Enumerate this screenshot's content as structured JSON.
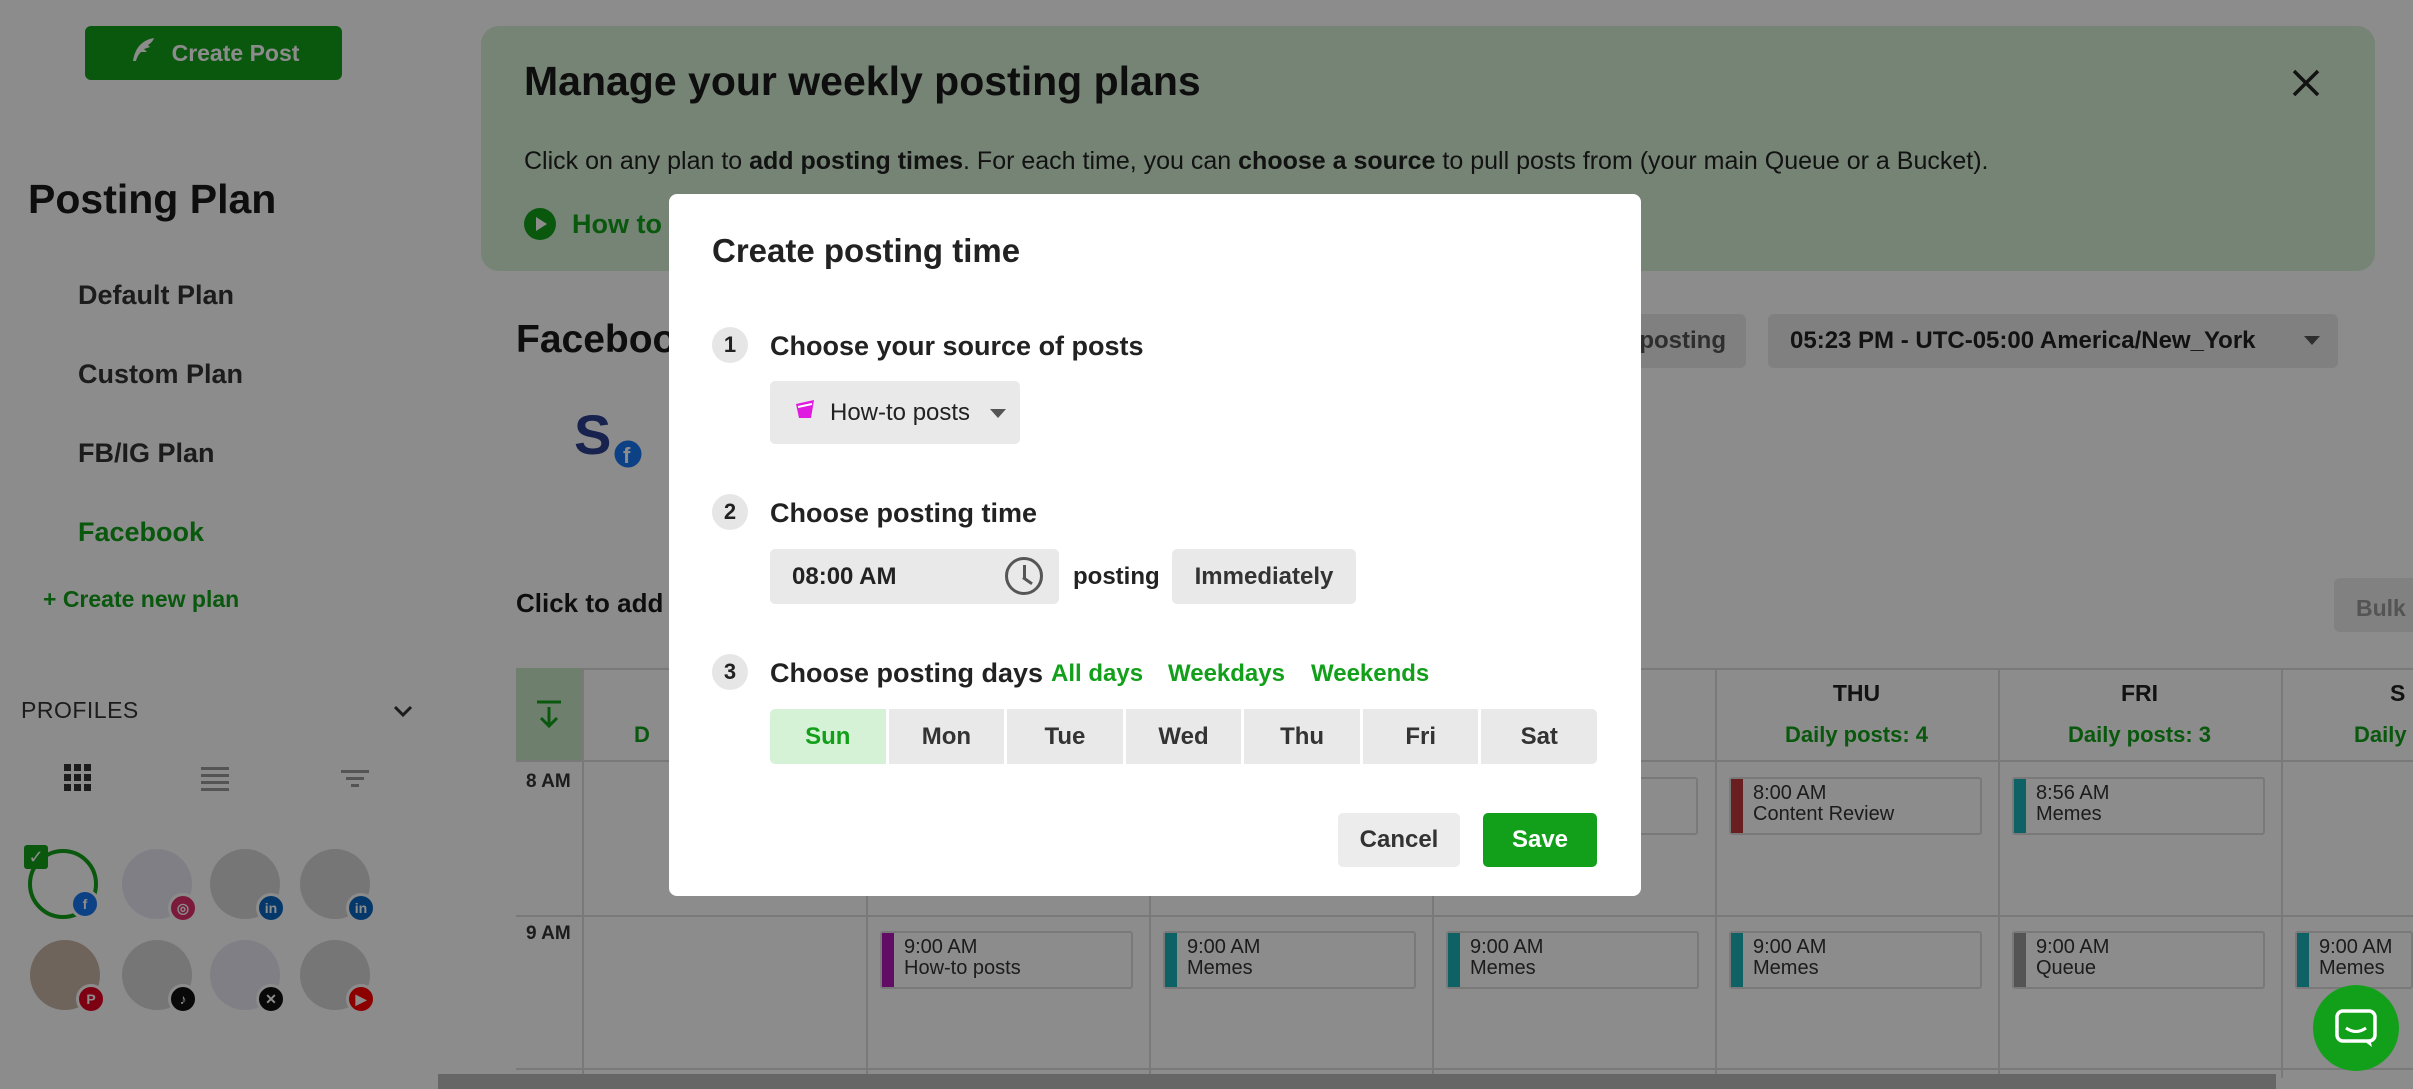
{
  "sidebar": {
    "create_post": "Create Post",
    "title": "Posting Plan",
    "plans": [
      "Default Plan",
      "Custom Plan",
      "FB/IG Plan",
      "Facebook"
    ],
    "active_plan": "Facebook",
    "new_plan": "+ Create new plan",
    "profiles_label": "PROFILES"
  },
  "banner": {
    "title": "Manage your weekly posting plans",
    "text_1": "Click on any plan to ",
    "text_bold_1": "add posting times",
    "text_2": ". For each time, you can ",
    "text_bold_2": "choose a source",
    "text_3": " to pull posts from (your main Queue or a Bucket).",
    "howto": "How to"
  },
  "main": {
    "section_title": "Faceboo",
    "pause_label": "posting",
    "timezone": "05:23 PM - UTC-05:00 America/New_York",
    "click_add": "Click to add p",
    "bulk": "Bulk a"
  },
  "calendar": {
    "days": [
      {
        "name": "",
        "sub": "D"
      },
      {
        "name": "",
        "sub": ""
      },
      {
        "name": "",
        "sub": ""
      },
      {
        "name": "",
        "sub": "."
      },
      {
        "name": "THU",
        "sub": "Daily posts: 4"
      },
      {
        "name": "FRI",
        "sub": "Daily posts: 3"
      },
      {
        "name": "S",
        "sub": "Daily"
      }
    ],
    "hours": [
      "8 AM",
      "9 AM"
    ],
    "slots": [
      {
        "time": "8:00 AM",
        "source": "Content Review",
        "color": "#c0393b"
      },
      {
        "time": "8:56 AM",
        "source": "Memes",
        "color": "#1ab3b8"
      },
      {
        "time": "9:00 AM",
        "source": "How-to posts",
        "color": "#b316b8"
      },
      {
        "time": "9:00 AM",
        "source": "Memes",
        "color": "#1ab3b8"
      },
      {
        "time": "9:00 AM",
        "source": "Memes",
        "color": "#1ab3b8"
      },
      {
        "time": "9:00 AM",
        "source": "Memes",
        "color": "#1ab3b8"
      },
      {
        "time": "9:00 AM",
        "source": "Queue",
        "color": "#999999"
      },
      {
        "time": "9:00 AM",
        "source": "Memes",
        "color": "#1ab3b8"
      }
    ]
  },
  "modal": {
    "title": "Create posting time",
    "step1": {
      "num": "1",
      "label": "Choose your source of posts",
      "source": "How-to posts"
    },
    "step2": {
      "num": "2",
      "label": "Choose posting time",
      "time": "08:00 AM",
      "posting": "posting",
      "mode": "Immediately"
    },
    "step3": {
      "num": "3",
      "label": "Choose posting days",
      "all": "All days",
      "weekdays": "Weekdays",
      "weekends": "Weekends",
      "days": [
        "Sun",
        "Mon",
        "Tue",
        "Wed",
        "Thu",
        "Fri",
        "Sat"
      ],
      "selected": "Sun"
    },
    "cancel": "Cancel",
    "save": "Save"
  },
  "colors": {
    "accent": "#12a01a",
    "accent_light": "#d6f0d6"
  }
}
